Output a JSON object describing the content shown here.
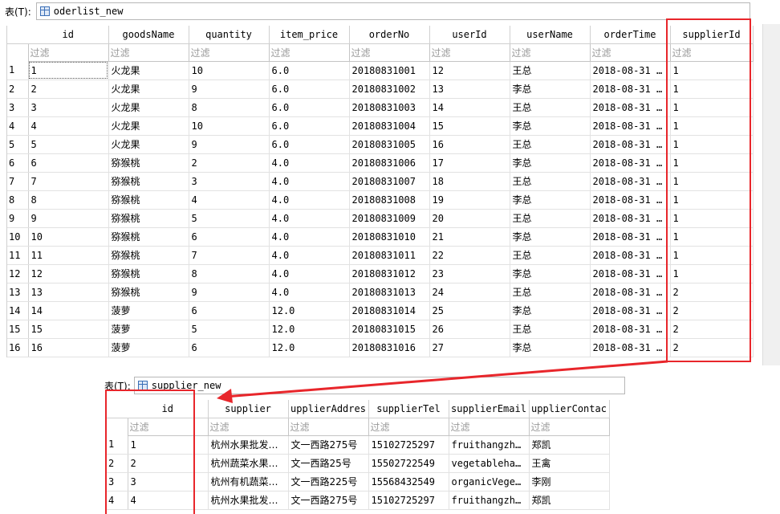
{
  "top": {
    "selector_label": "表(T):",
    "table_name": "oderlist_new",
    "columns": [
      "id",
      "goodsName",
      "quantity",
      "item_price",
      "orderNo",
      "userId",
      "userName",
      "orderTime",
      "supplierId"
    ],
    "filter_placeholder": "过滤",
    "rows": [
      {
        "n": "1",
        "id": "1",
        "goodsName": "火龙果",
        "quantity": "10",
        "item_price": "6.0",
        "orderNo": "20180831001",
        "userId": "12",
        "userName": "王总",
        "orderTime": "2018-08-31 …",
        "supplierId": "1"
      },
      {
        "n": "2",
        "id": "2",
        "goodsName": "火龙果",
        "quantity": "9",
        "item_price": "6.0",
        "orderNo": "20180831002",
        "userId": "13",
        "userName": "李总",
        "orderTime": "2018-08-31 …",
        "supplierId": "1"
      },
      {
        "n": "3",
        "id": "3",
        "goodsName": "火龙果",
        "quantity": "8",
        "item_price": "6.0",
        "orderNo": "20180831003",
        "userId": "14",
        "userName": "王总",
        "orderTime": "2018-08-31 …",
        "supplierId": "1"
      },
      {
        "n": "4",
        "id": "4",
        "goodsName": "火龙果",
        "quantity": "10",
        "item_price": "6.0",
        "orderNo": "20180831004",
        "userId": "15",
        "userName": "李总",
        "orderTime": "2018-08-31 …",
        "supplierId": "1"
      },
      {
        "n": "5",
        "id": "5",
        "goodsName": "火龙果",
        "quantity": "9",
        "item_price": "6.0",
        "orderNo": "20180831005",
        "userId": "16",
        "userName": "王总",
        "orderTime": "2018-08-31 …",
        "supplierId": "1"
      },
      {
        "n": "6",
        "id": "6",
        "goodsName": "猕猴桃",
        "quantity": "2",
        "item_price": "4.0",
        "orderNo": "20180831006",
        "userId": "17",
        "userName": "李总",
        "orderTime": "2018-08-31 …",
        "supplierId": "1"
      },
      {
        "n": "7",
        "id": "7",
        "goodsName": "猕猴桃",
        "quantity": "3",
        "item_price": "4.0",
        "orderNo": "20180831007",
        "userId": "18",
        "userName": "王总",
        "orderTime": "2018-08-31 …",
        "supplierId": "1"
      },
      {
        "n": "8",
        "id": "8",
        "goodsName": "猕猴桃",
        "quantity": "4",
        "item_price": "4.0",
        "orderNo": "20180831008",
        "userId": "19",
        "userName": "李总",
        "orderTime": "2018-08-31 …",
        "supplierId": "1"
      },
      {
        "n": "9",
        "id": "9",
        "goodsName": "猕猴桃",
        "quantity": "5",
        "item_price": "4.0",
        "orderNo": "20180831009",
        "userId": "20",
        "userName": "王总",
        "orderTime": "2018-08-31 …",
        "supplierId": "1"
      },
      {
        "n": "10",
        "id": "10",
        "goodsName": "猕猴桃",
        "quantity": "6",
        "item_price": "4.0",
        "orderNo": "20180831010",
        "userId": "21",
        "userName": "李总",
        "orderTime": "2018-08-31 …",
        "supplierId": "1"
      },
      {
        "n": "11",
        "id": "11",
        "goodsName": "猕猴桃",
        "quantity": "7",
        "item_price": "4.0",
        "orderNo": "20180831011",
        "userId": "22",
        "userName": "王总",
        "orderTime": "2018-08-31 …",
        "supplierId": "1"
      },
      {
        "n": "12",
        "id": "12",
        "goodsName": "猕猴桃",
        "quantity": "8",
        "item_price": "4.0",
        "orderNo": "20180831012",
        "userId": "23",
        "userName": "李总",
        "orderTime": "2018-08-31 …",
        "supplierId": "1"
      },
      {
        "n": "13",
        "id": "13",
        "goodsName": "猕猴桃",
        "quantity": "9",
        "item_price": "4.0",
        "orderNo": "20180831013",
        "userId": "24",
        "userName": "王总",
        "orderTime": "2018-08-31 …",
        "supplierId": "2"
      },
      {
        "n": "14",
        "id": "14",
        "goodsName": "菠萝",
        "quantity": "6",
        "item_price": "12.0",
        "orderNo": "20180831014",
        "userId": "25",
        "userName": "李总",
        "orderTime": "2018-08-31 …",
        "supplierId": "2"
      },
      {
        "n": "15",
        "id": "15",
        "goodsName": "菠萝",
        "quantity": "5",
        "item_price": "12.0",
        "orderNo": "20180831015",
        "userId": "26",
        "userName": "王总",
        "orderTime": "2018-08-31 …",
        "supplierId": "2"
      },
      {
        "n": "16",
        "id": "16",
        "goodsName": "菠萝",
        "quantity": "6",
        "item_price": "12.0",
        "orderNo": "20180831016",
        "userId": "27",
        "userName": "李总",
        "orderTime": "2018-08-31 …",
        "supplierId": "2"
      }
    ]
  },
  "bottom": {
    "selector_label": "表(T):",
    "table_name": "supplier_new",
    "columns": [
      "id",
      "supplier",
      "upplierAddres",
      "supplierTel",
      "supplierEmail",
      "upplierContac"
    ],
    "filter_placeholder": "过滤",
    "rows": [
      {
        "n": "1",
        "id": "1",
        "supplier": "杭州水果批发…",
        "address": "文一西路275号",
        "tel": "15102725297",
        "email": "fruithangzh…",
        "contact": "郑凯"
      },
      {
        "n": "2",
        "id": "2",
        "supplier": "杭州蔬菜水果…",
        "address": "文一西路25号",
        "tel": "15502722549",
        "email": "vegetableha…",
        "contact": "王禽"
      },
      {
        "n": "3",
        "id": "3",
        "supplier": "杭州有机蔬菜…",
        "address": "文一西路225号",
        "tel": "15568432549",
        "email": "organicVege…",
        "contact": "李刚"
      },
      {
        "n": "4",
        "id": "4",
        "supplier": "杭州水果批发…",
        "address": "文一西路275号",
        "tel": "15102725297",
        "email": "fruithangzh…",
        "contact": "郑凯"
      }
    ]
  },
  "annotation_color": "#e8262b"
}
